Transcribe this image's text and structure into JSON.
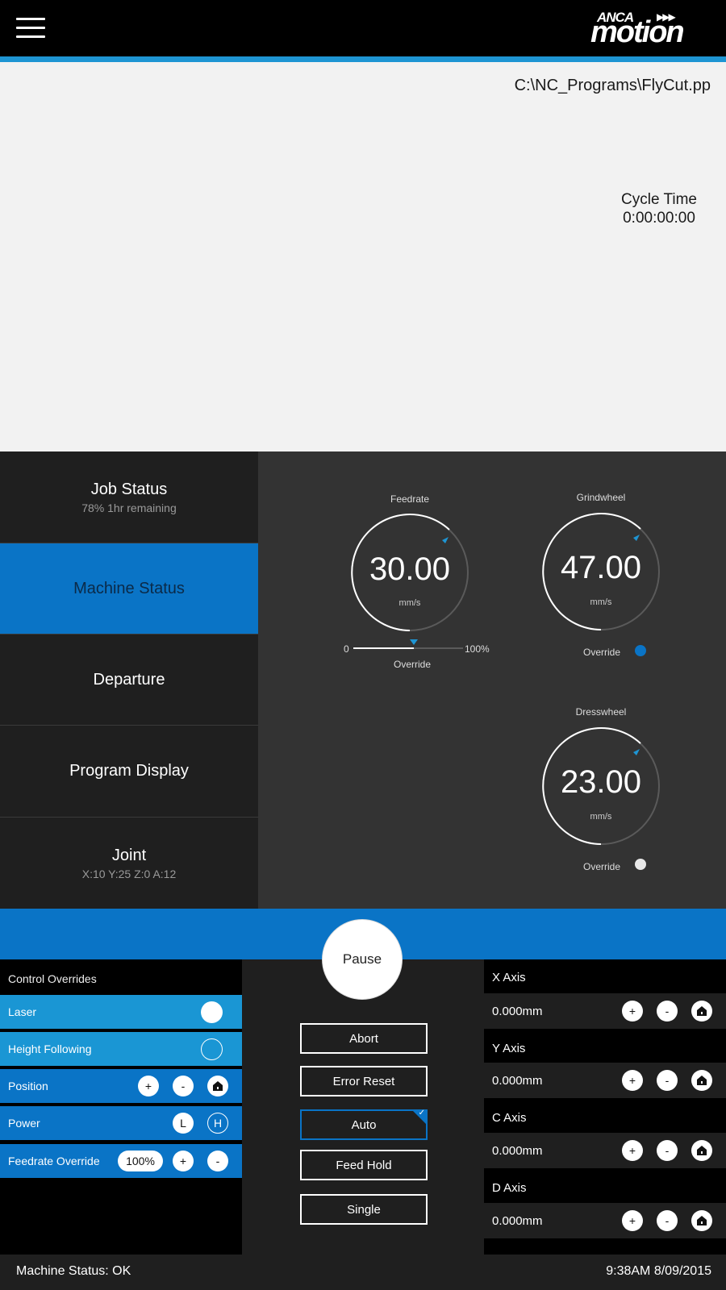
{
  "header": {
    "logo_top": "ANCA",
    "logo_main": "motion"
  },
  "preview": {
    "program_path": "C:\\NC_Programs\\FlyCut.pp",
    "cycle_label": "Cycle Time",
    "cycle_value": "0:00:00:00"
  },
  "nav": {
    "items": [
      {
        "title": "Job Status",
        "subtitle": "78% 1hr remaining"
      },
      {
        "title": "Machine Status",
        "subtitle": ""
      },
      {
        "title": "Departure",
        "subtitle": ""
      },
      {
        "title": "Program Display",
        "subtitle": ""
      },
      {
        "title": "Joint",
        "subtitle": "X:10  Y:25  Z:0  A:12"
      }
    ],
    "active_index": 1
  },
  "gauges": {
    "feedrate": {
      "title": "Feedrate",
      "value": "30.00",
      "unit": "mm/s",
      "slider_min": "0",
      "slider_max": "100%",
      "slider_label": "Override",
      "override_fraction": 0.55
    },
    "grindwheel": {
      "title": "Grindwheel",
      "value": "47.00",
      "unit": "mm/s",
      "override_label": "Override",
      "override_on": true
    },
    "dresswheel": {
      "title": "Dresswheel",
      "value": "23.00",
      "unit": "mm/s",
      "override_label": "Override",
      "override_on": false
    }
  },
  "pause_label": "Pause",
  "overrides": {
    "title": "Control Overrides",
    "laser": "Laser",
    "laser_on": true,
    "height": "Height Following",
    "height_on": false,
    "position": "Position",
    "power": "Power",
    "power_l": "L",
    "power_h": "H",
    "feed_override": "Feedrate Override",
    "feed_value": "100%",
    "plus": "+",
    "minus": "-"
  },
  "controls": {
    "abort": "Abort",
    "error_reset": "Error Reset",
    "auto": "Auto",
    "feed_hold": "Feed Hold",
    "single": "Single"
  },
  "axes": [
    {
      "name": "X Axis",
      "value": "0.000mm"
    },
    {
      "name": "Y Axis",
      "value": "0.000mm"
    },
    {
      "name": "C Axis",
      "value": "0.000mm"
    },
    {
      "name": "D Axis",
      "value": "0.000mm"
    }
  ],
  "footer": {
    "status": "Machine Status: OK",
    "datetime": "9:38AM 8/09/2015"
  },
  "colors": {
    "accent": "#1e95d3",
    "active_blue": "#0a74c6",
    "light_blue": "#1a96d4"
  }
}
